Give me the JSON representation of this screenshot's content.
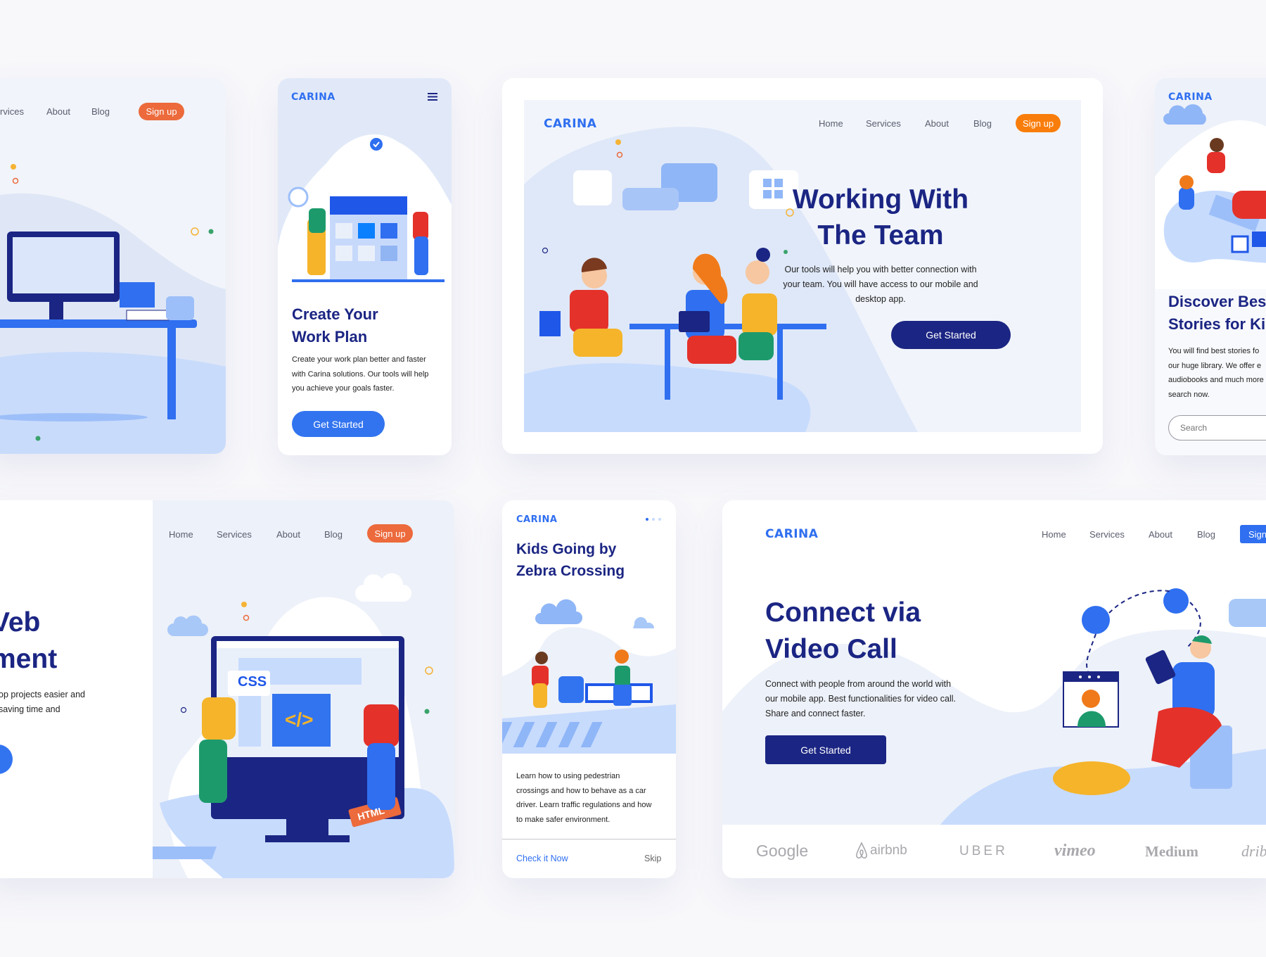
{
  "colors": {
    "navy": "#1b2583",
    "blue": "#2f6ff0",
    "orange": "#f07a1a",
    "coral": "#ec6a3c",
    "panel": "#eef2fa"
  },
  "card_a": {
    "nav": [
      "rvices",
      "About",
      "Blog"
    ],
    "signup": "Sign up"
  },
  "card_b": {
    "logo": "CARINA",
    "menu_icon": "hamburger-icon",
    "title_lines": [
      "Create Your",
      "Work Plan"
    ],
    "body_lines": [
      "Create your work plan better and faster",
      "with Carina solutions. Our tools will help",
      "you achieve your goals faster."
    ],
    "cta": "Get Started"
  },
  "card_c": {
    "logo": "CARINA",
    "nav": [
      "Home",
      "Services",
      "About",
      "Blog"
    ],
    "signup": "Sign up",
    "title_lines": [
      "Working With",
      "The Team"
    ],
    "body_lines": [
      "Our tools will help you with better connection with",
      "your team. You will have access to our mobile and",
      "desktop app."
    ],
    "cta": "Get Started"
  },
  "card_d": {
    "logo": "CARINA",
    "title_lines": [
      "Discover Best",
      "Stories for Ki"
    ],
    "body_lines": [
      "You will find best stories fo",
      "our huge library. We offer e",
      "audiobooks and much more",
      "search now."
    ],
    "search_placeholder": "Search"
  },
  "card_e": {
    "nav": [
      "Home",
      "Services",
      "About",
      "Blog"
    ],
    "signup": "Sign up",
    "title_lines": [
      "Veb",
      "ment"
    ],
    "body_lines": [
      "op projects easier and",
      " saving time and"
    ],
    "css_label": "CSS",
    "code_label": "</>",
    "html_label": "HTML"
  },
  "card_f": {
    "logo": "CARINA",
    "title_lines": [
      "Kids Going by",
      "Zebra Crossing"
    ],
    "body_lines": [
      "Learn how to using pedestrian",
      "crossings and how to behave as a car",
      "driver. Learn traffic regulations and how",
      "to make safer environment."
    ],
    "check_link": "Check it Now",
    "skip": "Skip"
  },
  "card_g": {
    "logo": "CARINA",
    "nav": [
      "Home",
      "Services",
      "About",
      "Blog"
    ],
    "signup": "Sign",
    "title_lines": [
      "Connect via",
      "Video Call"
    ],
    "body_lines": [
      "Connect with people from around the world with",
      "our mobile app. Best functionalities for video call.",
      "Share and connect faster."
    ],
    "cta": "Get Started",
    "brands": [
      "Google",
      "airbnb",
      "UBER",
      "vimeo",
      "Medium",
      "dribbble"
    ]
  }
}
